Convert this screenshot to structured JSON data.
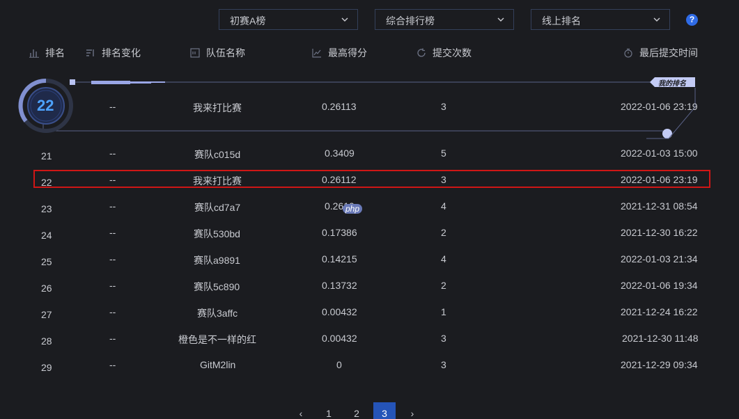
{
  "filters": {
    "stage": "初赛A榜",
    "board": "综合排行榜",
    "mode": "线上排名"
  },
  "columns": {
    "rank": "排名",
    "change": "排名变化",
    "team": "队伍名称",
    "score": "最高得分",
    "submits": "提交次数",
    "last_time": "最后提交时间"
  },
  "my_rank": {
    "badge_label": "我的排名",
    "rank": "22",
    "change": "--",
    "team": "我来打比赛",
    "score": "0.26113",
    "submits": "3",
    "last_time": "2022-01-06 23:19"
  },
  "rows": [
    {
      "rank": "21",
      "change": "--",
      "team": "赛队c015d",
      "score": "0.3409",
      "submits": "5",
      "time": "2022-01-03 15:00"
    },
    {
      "rank": "22",
      "change": "--",
      "team": "我来打比赛",
      "score": "0.26112",
      "submits": "3",
      "time": "2022-01-06 23:19"
    },
    {
      "rank": "23",
      "change": "--",
      "team": "赛队cd7a7",
      "score": "0.2610",
      "submits": "4",
      "time": "2021-12-31 08:54"
    },
    {
      "rank": "24",
      "change": "--",
      "team": "赛队530bd",
      "score": "0.17386",
      "submits": "2",
      "time": "2021-12-30 16:22"
    },
    {
      "rank": "25",
      "change": "--",
      "team": "赛队a9891",
      "score": "0.14215",
      "submits": "4",
      "time": "2022-01-03 21:34"
    },
    {
      "rank": "26",
      "change": "--",
      "team": "赛队5c890",
      "score": "0.13732",
      "submits": "2",
      "time": "2022-01-06 19:34"
    },
    {
      "rank": "27",
      "change": "--",
      "team": "赛队3affc",
      "score": "0.00432",
      "submits": "1",
      "time": "2021-12-24 16:22"
    },
    {
      "rank": "28",
      "change": "--",
      "team": "橙色是不一样的红",
      "score": "0.00432",
      "submits": "3",
      "time": "2021-12-30 11:48"
    },
    {
      "rank": "29",
      "change": "--",
      "team": "GitM2lin",
      "score": "0",
      "submits": "3",
      "time": "2021-12-29 09:34"
    }
  ],
  "pagination": {
    "pages": [
      "1",
      "2",
      "3"
    ],
    "current": "3",
    "prev": "‹",
    "next": "›"
  },
  "watermark": "php 中文网",
  "colors": {
    "background": "#1b1c20",
    "accent": "#2f6be6",
    "highlight_border": "#d01616",
    "badge_bg": "#c3cbf5"
  }
}
